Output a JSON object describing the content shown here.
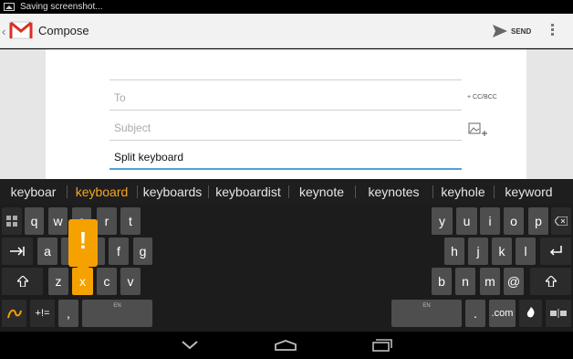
{
  "status_bar": {
    "text": "Saving screenshot..."
  },
  "action_bar": {
    "title": "Compose",
    "send_label": "SEND"
  },
  "compose": {
    "to_placeholder": "To",
    "ccbcc_label": "+ CC/BCC",
    "subject_placeholder": "Subject",
    "body_text": "Split keyboard"
  },
  "suggestions": [
    "keyboar",
    "keyboard",
    "keyboards",
    "keyboardist",
    "keynote",
    "keynotes",
    "keyhole",
    "keyword"
  ],
  "keyboard": {
    "left": {
      "row1": [
        "q",
        "w",
        "e",
        "r",
        "t"
      ],
      "row2": [
        "a",
        "s",
        "d",
        "f",
        "g"
      ],
      "row3": [
        "z",
        "x",
        "c",
        "v"
      ],
      "symbols_label": "+!=",
      "comma_label": ",",
      "en_label": "EN"
    },
    "right": {
      "row1": [
        "y",
        "u",
        "i",
        "o",
        "p"
      ],
      "row2": [
        "h",
        "j",
        "k",
        "l"
      ],
      "row3": [
        "b",
        "n",
        "m",
        "@"
      ],
      "period_label": ".",
      "com_label": ".com",
      "en_label": "EN"
    },
    "popup_char": "!"
  },
  "colors": {
    "accent": "#f5a100",
    "underline": "#4aa3d8",
    "key": "#4e4e4e"
  },
  "icons": [
    "image-icon",
    "gmail-icon",
    "send-icon",
    "overflow-icon",
    "attach-image-icon",
    "grid-icon",
    "tab-icon",
    "shift-icon",
    "swype-icon",
    "backspace-icon",
    "enter-icon",
    "voice-icon",
    "split-icon",
    "nav-back-icon",
    "nav-home-icon",
    "nav-recent-icon"
  ]
}
